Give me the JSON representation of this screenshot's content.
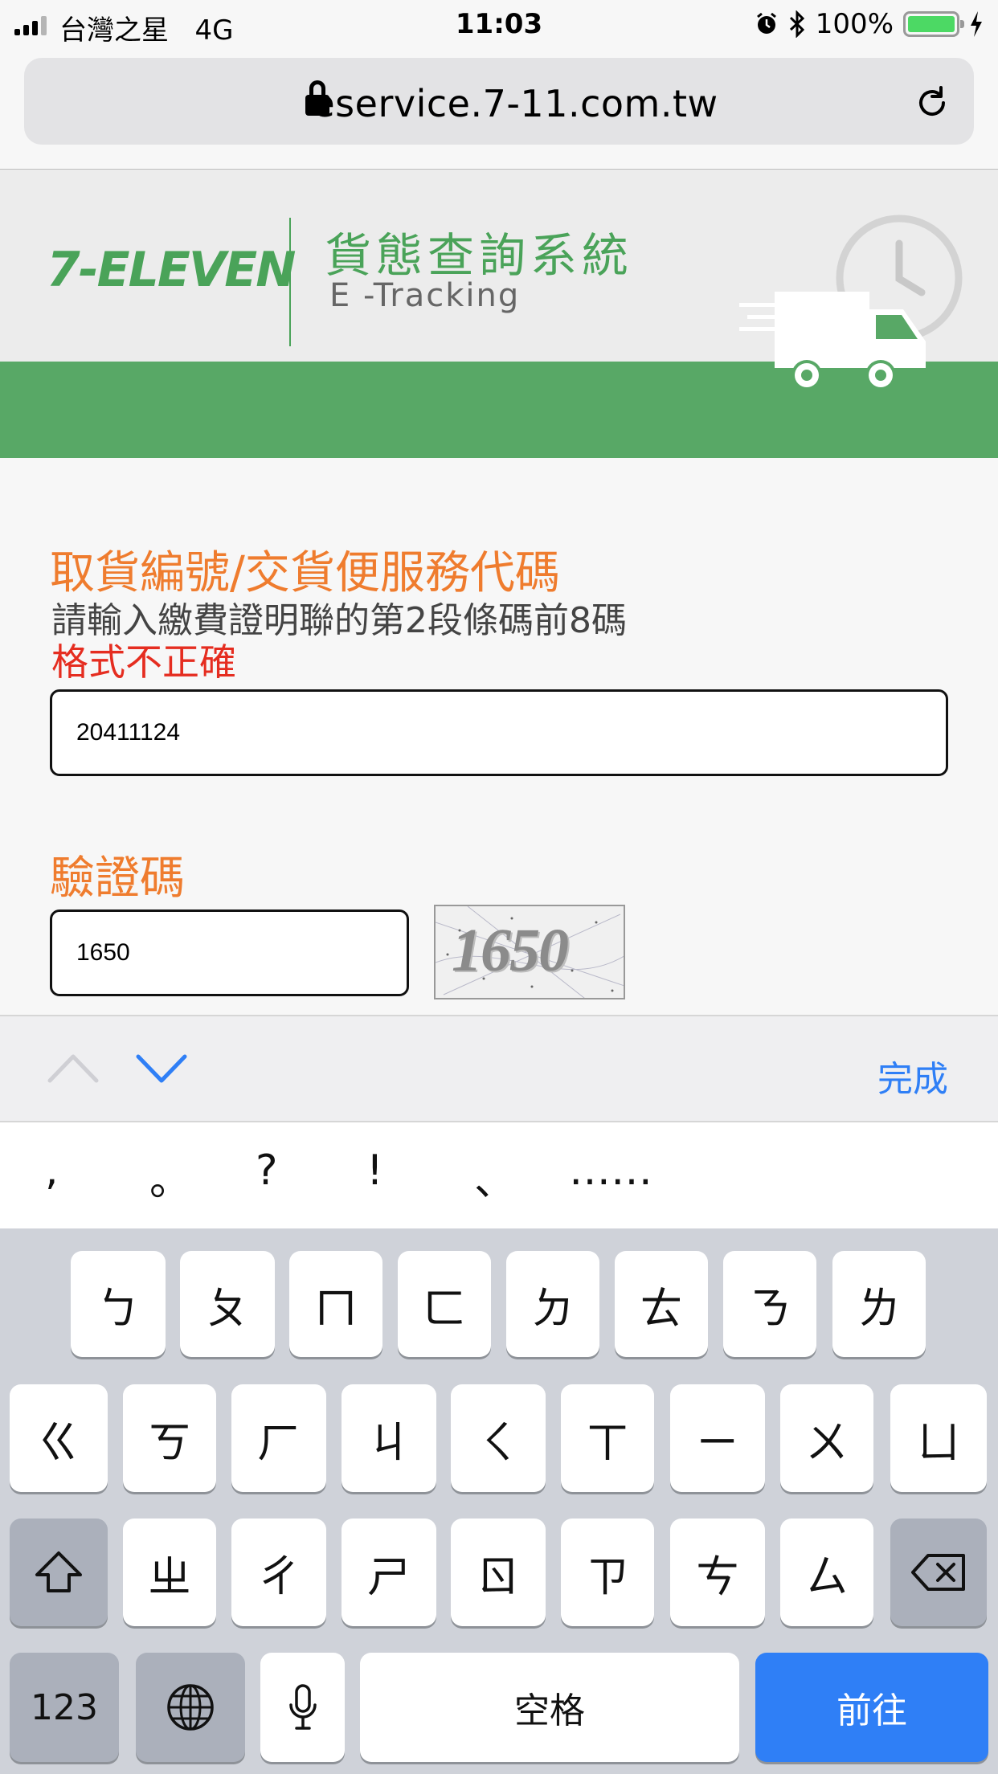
{
  "status_bar": {
    "carrier": "台灣之星",
    "network": "4G",
    "time": "11:03",
    "battery": "100%",
    "icons": [
      "signal-icon",
      "alarm-icon",
      "bluetooth-icon",
      "battery-icon",
      "charging-icon"
    ]
  },
  "browser": {
    "url": "eservice.7-11.com.tw"
  },
  "site": {
    "logo": "7-ELEVEN",
    "title_zh": "貨態查詢系統",
    "title_en": "E -Tracking",
    "colors": {
      "brand_green": "#4aa359",
      "bar_green": "#58a866",
      "label_orange": "#ef7c2e",
      "error_red": "#e52d20"
    }
  },
  "form": {
    "pickup_label": "取貨編號/交貨便服務代碼",
    "pickup_hint": "請輸入繳費證明聯的第2段條碼前8碼",
    "pickup_error": "格式不正確",
    "pickup_value": "20411124",
    "captcha_label": "驗證碼",
    "captcha_value": "1650",
    "captcha_image_text": "1650"
  },
  "accessory": {
    "done": "完成"
  },
  "suggestions": [
    ",",
    "。",
    "?",
    "!",
    "、",
    "……"
  ],
  "keyboard": {
    "row1": [
      "ㄅ",
      "ㄆ",
      "ㄇ",
      "ㄈ",
      "ㄉ",
      "ㄊ",
      "ㄋ",
      "ㄌ"
    ],
    "row2": [
      "ㄍ",
      "ㄎ",
      "ㄏ",
      "ㄐ",
      "ㄑ",
      "ㄒ",
      "ㄧ",
      "ㄨ",
      "ㄩ"
    ],
    "row3": [
      "ㄓ",
      "ㄔ",
      "ㄕ",
      "ㄖ",
      "ㄗ",
      "ㄘ",
      "ㄙ"
    ],
    "numbers": "123",
    "space": "空格",
    "go": "前往"
  }
}
